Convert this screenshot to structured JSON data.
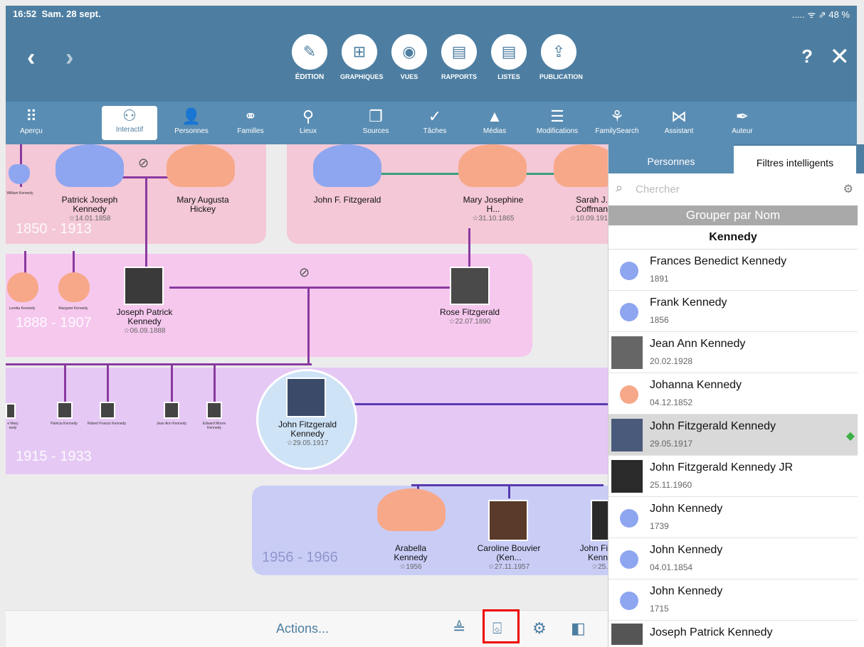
{
  "status": {
    "time": "16:52",
    "date": "Sam. 28 sept.",
    "right": "..... ᯤ ⇗ 48 %"
  },
  "modes": [
    {
      "label": "ÉDITION",
      "icon": "✎"
    },
    {
      "label": "GRAPHIQUES",
      "icon": "⊞"
    },
    {
      "label": "VUES",
      "icon": "◉"
    },
    {
      "label": "RAPPORTS",
      "icon": "▤"
    },
    {
      "label": "LISTES",
      "icon": "▤"
    },
    {
      "label": "PUBLICATION",
      "icon": "⇪"
    }
  ],
  "header": {
    "help": "?",
    "close": "✕",
    "back": "‹",
    "forward": "›"
  },
  "tools": [
    {
      "label": "Aperçu",
      "icon": "⠿"
    },
    {
      "label": "Interactif",
      "icon": "⚇"
    },
    {
      "label": "Personnes",
      "icon": "👤"
    },
    {
      "label": "Familles",
      "icon": "⚭"
    },
    {
      "label": "Lieux",
      "icon": "⚲"
    },
    {
      "label": "Sources",
      "icon": "❐"
    },
    {
      "label": "Tâches",
      "icon": "✓"
    },
    {
      "label": "Médias",
      "icon": "▲"
    },
    {
      "label": "Modifications",
      "icon": "☰"
    },
    {
      "label": "FamilySearch",
      "icon": "⚘"
    },
    {
      "label": "Assistant",
      "icon": "⋈"
    },
    {
      "label": "Auteur",
      "icon": "✒"
    }
  ],
  "chart": {
    "eras": [
      "1850 - 1913",
      "1888 - 1907",
      "1915 - 1933",
      "1956 - 1966"
    ],
    "people": [
      {
        "name": "Patrick Joseph Kennedy",
        "date": "☆14.01.1858"
      },
      {
        "name": "Mary Augusta Hickey",
        "date": ""
      },
      {
        "name": "John F. Fitzgerald",
        "date": ""
      },
      {
        "name": "Mary Josephine H...",
        "date": "☆31.10.1865"
      },
      {
        "name": "Sarah J. Coffman",
        "date": "☆10.09.191"
      },
      {
        "name": "Joseph Patrick Kennedy",
        "date": "☆06.09.1888"
      },
      {
        "name": "Rose Fitzgerald",
        "date": "☆22.07.1890"
      },
      {
        "name": "John Fitzgerald Kennedy",
        "date": "☆29.05.1917"
      },
      {
        "name": "Arabella Kennedy",
        "date": "☆1956"
      },
      {
        "name": "Caroline Bouvier (Ken...",
        "date": "☆27.11.1957"
      },
      {
        "name": "John Fi Kenn",
        "date": "☆25."
      }
    ],
    "tiny": [
      "William Kennedy",
      "Loretta Kennedy",
      "Margaret Kennedy",
      "e Mary nedy",
      "Patricia Kennedy",
      "Robert Francis Kennedy",
      "Jean Ann Kennedy",
      "Edward Moore Kennedy"
    ]
  },
  "bottom": {
    "actions": "Actions..."
  },
  "panel": {
    "tab_persons": "Personnes",
    "tab_filters": "Filtres intelligents",
    "search_placeholder": "Chercher",
    "group_by": "Grouper par Nom",
    "group_header": "Kennedy",
    "rows": [
      {
        "name": "Frances Benedict Kennedy",
        "date": "1891",
        "kind": "male"
      },
      {
        "name": "Frank Kennedy",
        "date": "1856",
        "kind": "male"
      },
      {
        "name": "Jean Ann Kennedy",
        "date": "20.02.1928",
        "kind": "photo"
      },
      {
        "name": "Johanna Kennedy",
        "date": "04.12.1852",
        "kind": "female"
      },
      {
        "name": "John Fitzgerald Kennedy",
        "date": "29.05.1917",
        "kind": "photo"
      },
      {
        "name": "John Fitzgerald Kennedy JR",
        "date": "25.11.1960",
        "kind": "photo"
      },
      {
        "name": "John Kennedy",
        "date": "1739",
        "kind": "male"
      },
      {
        "name": "John Kennedy",
        "date": "04.01.1854",
        "kind": "male"
      },
      {
        "name": "John Kennedy",
        "date": "1715",
        "kind": "male"
      },
      {
        "name": "Joseph Patrick Kennedy",
        "date": "",
        "kind": "photo"
      }
    ]
  },
  "colors": {
    "header": "#4d7ea1",
    "toolbar": "#5a8db3",
    "male": "#8ea6f0",
    "female": "#f7a889",
    "selected": "#d9d9d9"
  }
}
